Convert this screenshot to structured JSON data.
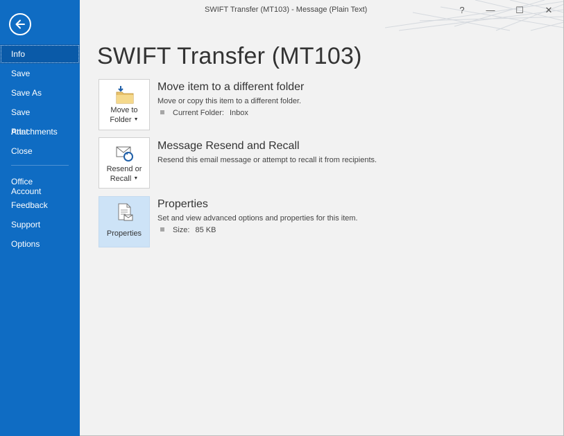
{
  "window": {
    "title": "SWIFT Transfer (MT103)  -  Message (Plain Text)",
    "help": "?",
    "minimize": "—",
    "restore": "☐",
    "close": "✕"
  },
  "sidebar": {
    "items": [
      {
        "label": "Info"
      },
      {
        "label": "Save"
      },
      {
        "label": "Save As"
      },
      {
        "label": "Save Attachments"
      },
      {
        "label": "Print"
      },
      {
        "label": "Close"
      },
      {
        "label_line1": "Office",
        "label_line2": "Account"
      },
      {
        "label": "Feedback"
      },
      {
        "label": "Support"
      },
      {
        "label": "Options"
      }
    ]
  },
  "main": {
    "title": "SWIFT Transfer (MT103)",
    "sections": [
      {
        "button_line1": "Move to",
        "button_line2": "Folder",
        "title": "Move item to a different folder",
        "description": "Move or copy this item to a different folder.",
        "detail_label": "Current Folder:",
        "detail_value": "Inbox"
      },
      {
        "button_line1": "Resend or",
        "button_line2": "Recall",
        "title": "Message Resend and Recall",
        "description": "Resend this email message or attempt to recall it from recipients."
      },
      {
        "button_line1": "Properties",
        "title": "Properties",
        "description": "Set and view advanced options and properties for this item.",
        "detail_label": "Size:",
        "detail_value": "85 KB"
      }
    ]
  },
  "colors": {
    "sidebar": "#0f6cc3",
    "selected_tile": "#cde3f7",
    "background": "#f2f2f2"
  }
}
